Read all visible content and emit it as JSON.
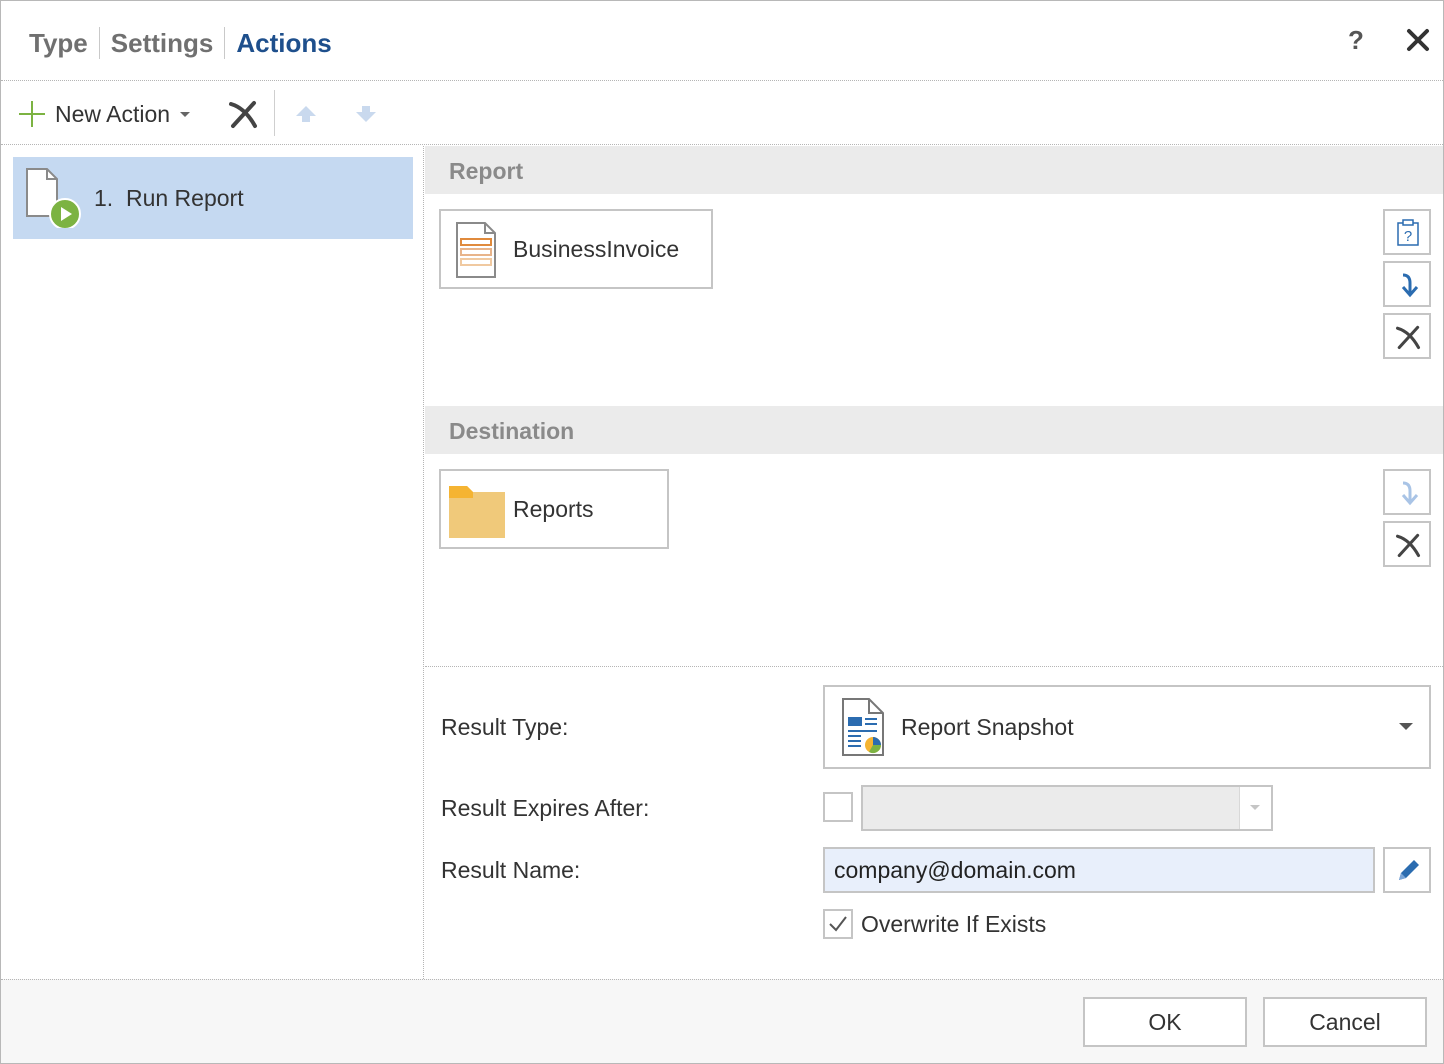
{
  "header": {
    "tabs": [
      {
        "label": "Type",
        "active": false
      },
      {
        "label": "Settings",
        "active": false
      },
      {
        "label": "Actions",
        "active": true
      }
    ],
    "help_label": "?",
    "close_icon": "close-icon"
  },
  "toolbar": {
    "new_action_label": "New Action",
    "icons": [
      "plus-icon",
      "chevron-down-icon",
      "delete-icon",
      "arrow-up-icon",
      "arrow-down-icon"
    ]
  },
  "actions": [
    {
      "number": "1.",
      "label": "Run Report",
      "selected": true,
      "icon": "run-report-icon"
    }
  ],
  "report_section": {
    "title": "Report",
    "item": {
      "label": "BusinessInvoice",
      "icon": "report-icon"
    },
    "buttons": [
      "select-report-icon",
      "import-icon",
      "delete-icon"
    ]
  },
  "destination_section": {
    "title": "Destination",
    "item": {
      "label": "Reports",
      "icon": "folder-icon"
    },
    "buttons": [
      "import-icon",
      "delete-icon"
    ]
  },
  "form": {
    "result_type_label": "Result Type:",
    "result_type_value": "Report Snapshot",
    "result_expires_label": "Result Expires After:",
    "result_expires_checked": false,
    "result_expires_value": "",
    "result_name_label": "Result Name:",
    "result_name_value": "company@domain.com",
    "overwrite_label": "Overwrite If Exists",
    "overwrite_checked": true
  },
  "footer": {
    "ok_label": "OK",
    "cancel_label": "Cancel"
  },
  "colors": {
    "accent": "#1e4f8c",
    "selection": "#c5d9f1",
    "section_header": "#ebebeb",
    "run_green": "#7cb342",
    "folder": "#f0c97a",
    "icon_blue": "#2b6cb0"
  }
}
